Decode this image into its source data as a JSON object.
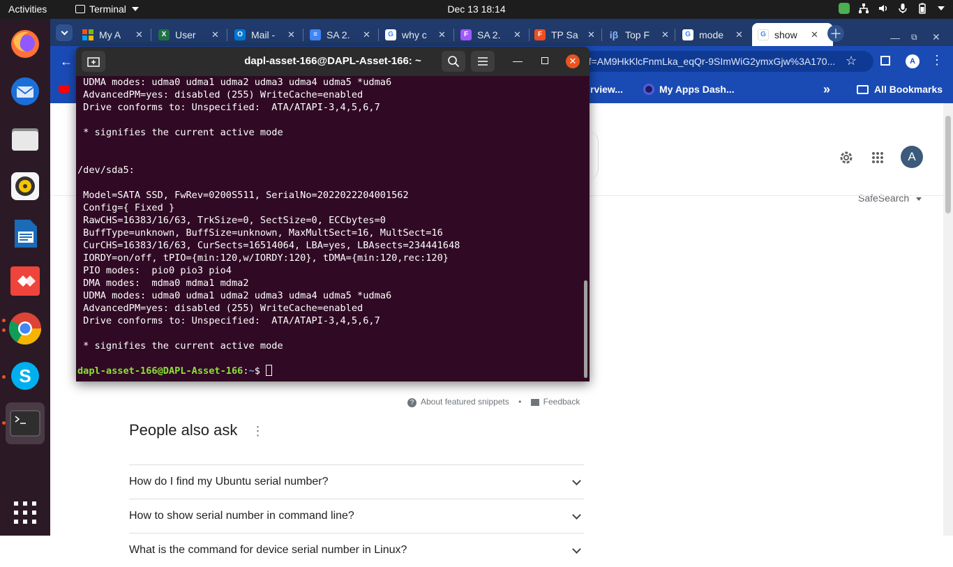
{
  "topbar": {
    "activities": "Activities",
    "app_name": "Terminal",
    "clock": "Dec 13  18:14"
  },
  "dock": {
    "items": [
      {
        "name": "firefox-icon"
      },
      {
        "name": "thunderbird-icon"
      },
      {
        "name": "files-icon"
      },
      {
        "name": "rhythmbox-icon"
      },
      {
        "name": "writer-icon"
      },
      {
        "name": "anydesk-icon"
      },
      {
        "name": "chrome-icon"
      },
      {
        "name": "skype-icon"
      },
      {
        "name": "terminal-icon"
      }
    ]
  },
  "chrome": {
    "tabs": [
      {
        "label": "My A",
        "favicon_color": "#f25022"
      },
      {
        "label": "User",
        "favicon_color": "#1e7145"
      },
      {
        "label": "Mail -",
        "favicon_color": "#0078d4"
      },
      {
        "label": "SA 2.",
        "favicon_color": "#4285f4"
      },
      {
        "label": "why c",
        "favicon_color": "#ffffff"
      },
      {
        "label": "SA 2.",
        "favicon_color": "#f24e1e"
      },
      {
        "label": "TP Sa",
        "favicon_color": "#f24e1e"
      },
      {
        "label": "Top F",
        "favicon_color": "#1f3a6b"
      },
      {
        "label": "mode",
        "favicon_color": "#ffffff"
      },
      {
        "label": "show",
        "favicon_color": "#ffffff"
      }
    ],
    "omnibox_text": "srf=AM9HkKlcFnmLka_eqQr-9SImWiG2ymxGjw%3A170...",
    "bookmarks": {
      "item1": "rview...",
      "item2": "My Apps Dash...",
      "all": "All Bookmarks"
    },
    "avatar_letter": "A"
  },
  "page": {
    "safesearch": "SafeSearch",
    "featured_about": "About featured snippets",
    "feedback": "Feedback",
    "paa_title": "People also ask",
    "paa_questions": [
      "How do I find my Ubuntu serial number?",
      "How to show serial number in command line?",
      "What is the command for device serial number in Linux?"
    ],
    "avatar_letter": "A"
  },
  "terminal": {
    "title": "dapl-asset-166@DAPL-Asset-166: ~",
    "lines": [
      " UDMA modes: udma0 udma1 udma2 udma3 udma4 udma5 *udma6",
      " AdvancedPM=yes: disabled (255) WriteCache=enabled",
      " Drive conforms to: Unspecified:  ATA/ATAPI-3,4,5,6,7",
      "",
      " * signifies the current active mode",
      "",
      "",
      "/dev/sda5:",
      "",
      " Model=SATA SSD, FwRev=0200S511, SerialNo=2022022204001562",
      " Config={ Fixed }",
      " RawCHS=16383/16/63, TrkSize=0, SectSize=0, ECCbytes=0",
      " BuffType=unknown, BuffSize=unknown, MaxMultSect=16, MultSect=16",
      " CurCHS=16383/16/63, CurSects=16514064, LBA=yes, LBAsects=234441648",
      " IORDY=on/off, tPIO={min:120,w/IORDY:120}, tDMA={min:120,rec:120}",
      " PIO modes:  pio0 pio3 pio4",
      " DMA modes:  mdma0 mdma1 mdma2",
      " UDMA modes: udma0 udma1 udma2 udma3 udma4 udma5 *udma6",
      " AdvancedPM=yes: disabled (255) WriteCache=enabled",
      " Drive conforms to: Unspecified:  ATA/ATAPI-3,4,5,6,7",
      "",
      " * signifies the current active mode",
      ""
    ],
    "prompt_user": "dapl-asset-166@DAPL-Asset-166",
    "prompt_sep": ":",
    "prompt_path": "~",
    "prompt_symbol": "$ "
  }
}
